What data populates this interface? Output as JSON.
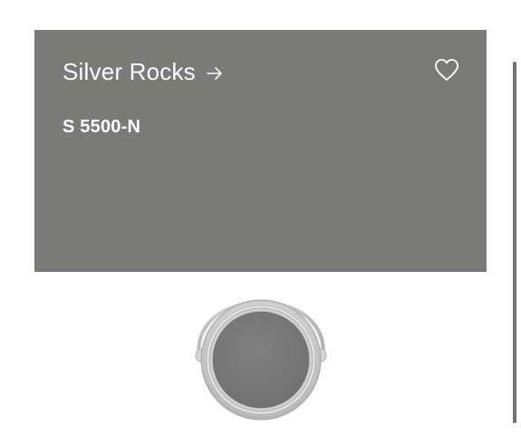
{
  "swatch": {
    "name": "Silver Rocks",
    "code": "S 5500-N",
    "background_color": "#7a7a79",
    "text_color": "#ffffff"
  },
  "icons": {
    "arrow": "arrow-right-icon",
    "favorite": "heart-outline-icon"
  },
  "product_image": {
    "icon": "paint-can-icon",
    "paint_color": "#7a7a79"
  },
  "scrollbar": {
    "thumb_color": "#727272"
  }
}
